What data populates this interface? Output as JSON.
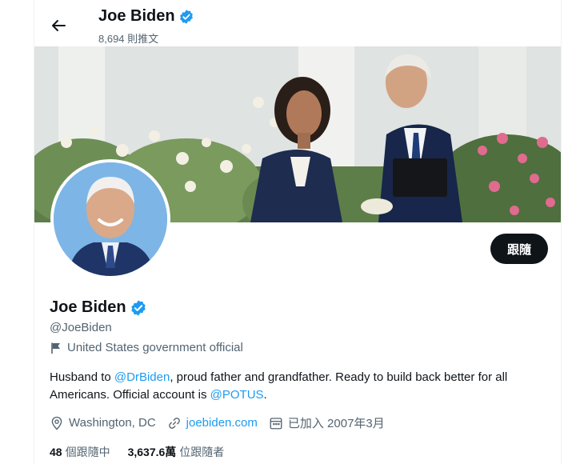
{
  "header": {
    "name": "Joe Biden",
    "tweet_count": "8,694 則推文"
  },
  "profile": {
    "name": "Joe Biden",
    "handle": "@JoeBiden",
    "affiliation": "United States government official",
    "bio": {
      "part1": "Husband to ",
      "mention1": "@DrBiden",
      "part2": ", proud father and grandfather. Ready to build back better for all Americans. Official account is ",
      "mention2": "@POTUS",
      "part3": "."
    },
    "location": "Washington, DC",
    "website": "joebiden.com",
    "joined": "已加入 2007年3月",
    "following_count": "48",
    "following_label": "個跟隨中",
    "followers_count": "3,637.6萬",
    "followers_label": "位跟隨者",
    "follow_button": "跟隨"
  },
  "colors": {
    "accent": "#1d9bf0",
    "verified": "#1d9bf0",
    "button": "#0f1419"
  },
  "icons": [
    "back-arrow-icon",
    "verified-badge-icon",
    "flag-icon",
    "location-pin-icon",
    "link-icon",
    "calendar-icon"
  ]
}
